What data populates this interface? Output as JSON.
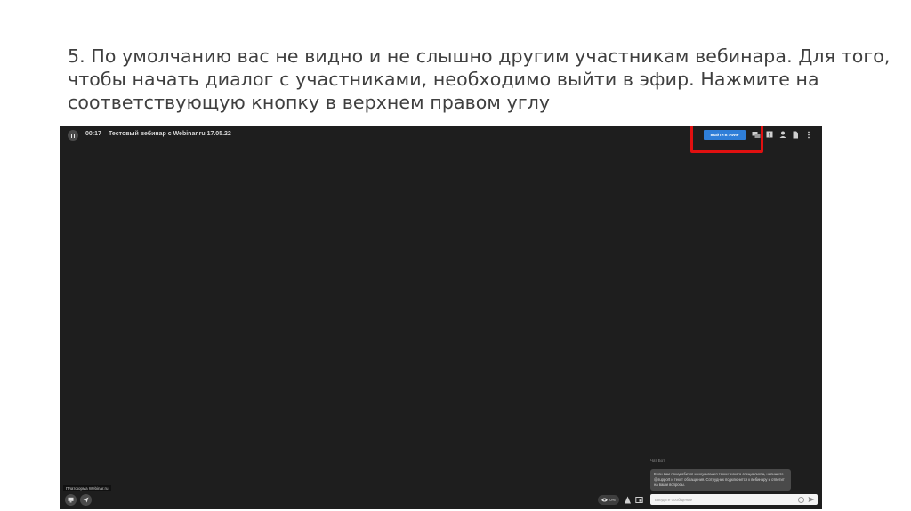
{
  "slide": {
    "text_lines": [
      "5. По умолчанию вас не видно и не слышно другим участникам вебинара. Для того,",
      "чтобы начать диалог с участниками, необходимо выйти в эфир. Нажмите на",
      "соответствующую кнопку в верхнем правом углу"
    ]
  },
  "player": {
    "timer": "00:17",
    "title": "Тестовый вебинар с Webinar.ru 17.05.22",
    "go_live_label": "ВЫЙТИ В ЭФИР",
    "highlight_color": "#e01010",
    "top_icons": [
      "chat-icon",
      "questions-icon",
      "participants-icon",
      "files-icon",
      "more-icon"
    ]
  },
  "chat": {
    "panel_label": "Чат Бот",
    "message": "Если вам понадобится консультация технического специалиста, напишите @support и текст обращения. Сотрудник подключится к вебинару и ответит на ваши вопросы.",
    "input_placeholder": "Введите сообщение"
  },
  "footer": {
    "platform_label": "Платформа Webinar.ru",
    "viewers_count": "0%"
  },
  "colors": {
    "app_background": "#1e1e1e",
    "accent": "#2f7ed8",
    "slide_text": "#3f3f3f"
  }
}
